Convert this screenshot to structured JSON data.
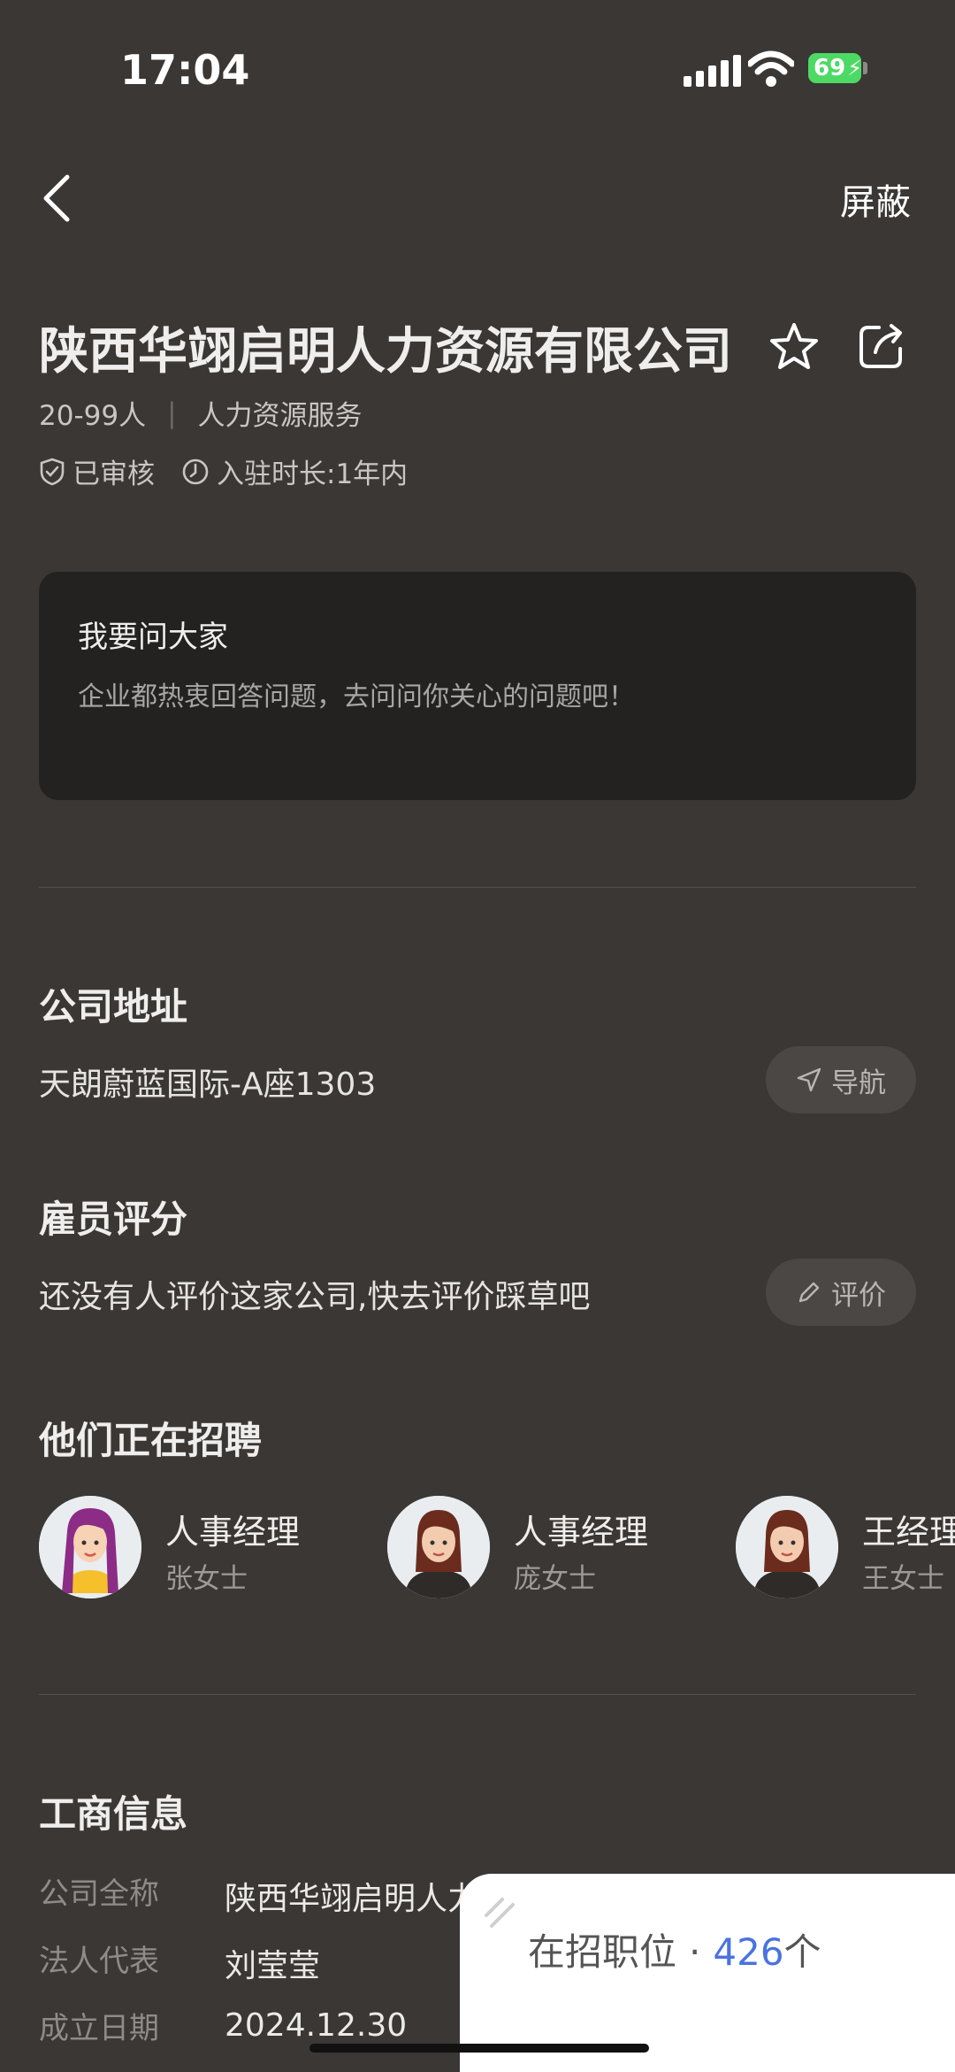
{
  "status_bar": {
    "time": "17:04",
    "battery": "69"
  },
  "nav": {
    "block_label": "屏蔽"
  },
  "company": {
    "name": "陕西华翊启明人力资源有限公司",
    "size": "20-99人",
    "industry": "人力资源服务",
    "verified": "已审核",
    "tenure": "入驻时长:1年内"
  },
  "ask": {
    "title": "我要问大家",
    "subtitle": "企业都热衷回答问题，去问问你关心的问题吧！"
  },
  "address": {
    "title": "公司地址",
    "text": "天朗蔚蓝国际-A座1303",
    "nav_label": "导航"
  },
  "rating": {
    "title": "雇员评分",
    "text": "还没有人评价这家公司,快去评价踩草吧",
    "rate_label": "评价"
  },
  "hiring": {
    "title": "他们正在招聘",
    "recruiters": [
      {
        "title": "人事经理",
        "name": "张女士"
      },
      {
        "title": "人事经理",
        "name": "庞女士"
      },
      {
        "title": "王经理",
        "name": "王女士"
      }
    ]
  },
  "business": {
    "title": "工商信息",
    "rows": [
      {
        "label": "公司全称",
        "value": "陕西华翊启明人力"
      },
      {
        "label": "法人代表",
        "value": "刘莹莹"
      },
      {
        "label": "成立日期",
        "value": "2024.12.30"
      }
    ]
  },
  "sheet": {
    "label": "在招职位",
    "dot": "·",
    "count": "426",
    "unit": "个"
  },
  "colors": {
    "background": "#3a3735",
    "card": "#242221",
    "accent": "#4a72e0",
    "battery": "#4cd964"
  }
}
